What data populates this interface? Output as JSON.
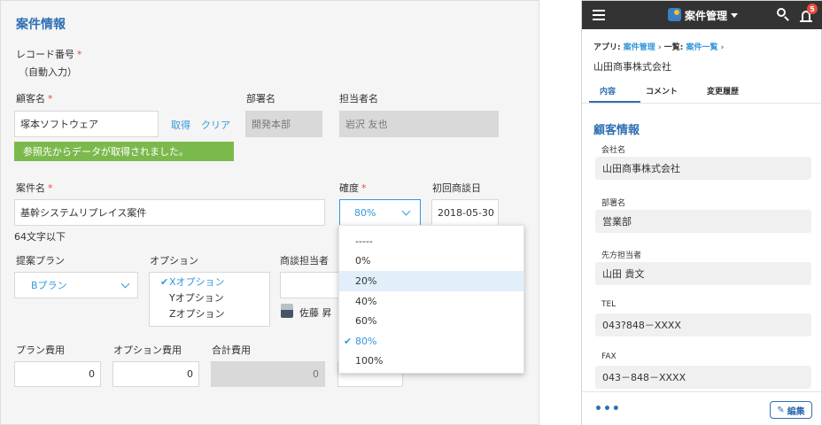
{
  "form": {
    "section_title": "案件情報",
    "record_number": {
      "label": "レコード番号",
      "value": "（自動入力）"
    },
    "customer": {
      "label": "顧客名",
      "value": "塚本ソフトウェア",
      "fetch": "取得",
      "clear": "クリア"
    },
    "department": {
      "label": "部署名",
      "value": "開発本部"
    },
    "contact": {
      "label": "担当者名",
      "value": "岩沢 友也"
    },
    "success_message": "参照先からデータが取得されました。",
    "project": {
      "label": "案件名",
      "value": "基幹システムリプレイス案件",
      "hint": "64文字以下"
    },
    "probability": {
      "label": "確度",
      "value": "80%"
    },
    "first_meeting": {
      "label": "初回商談日",
      "value": "2018-05-30"
    },
    "plan": {
      "label": "提案プラン",
      "value": "Bプラン"
    },
    "options": {
      "label": "オプション",
      "items": [
        {
          "label": "Xオプション",
          "checked": true
        },
        {
          "label": "Yオプション",
          "checked": false
        },
        {
          "label": "Zオプション",
          "checked": false
        }
      ]
    },
    "sales_rep": {
      "label": "商談担当者",
      "user": "佐藤 昇"
    },
    "plan_cost": {
      "label": "プラン費用",
      "value": "0"
    },
    "option_cost": {
      "label": "オプション費用",
      "value": "0"
    },
    "total_cost": {
      "label": "合計費用",
      "value": "0"
    },
    "probability_dropdown": {
      "options": [
        "-----",
        "0%",
        "20%",
        "40%",
        "60%",
        "80%",
        "100%"
      ],
      "highlighted": "20%",
      "selected": "80%"
    }
  },
  "mobile": {
    "app_title": "案件管理",
    "notification_count": "5",
    "breadcrumb": {
      "app_prefix": "アプリ:",
      "app_link": "案件管理",
      "list_prefix": "一覧:",
      "list_link": "案件一覧"
    },
    "record_title": "山田商事株式会社",
    "tabs": [
      "内容",
      "コメント",
      "変更履歴"
    ],
    "section_title": "顧客情報",
    "fields": [
      {
        "label": "会社名",
        "value": "山田商事株式会社"
      },
      {
        "label": "部署名",
        "value": "営業部"
      },
      {
        "label": "先方担当者",
        "value": "山田 貴文"
      },
      {
        "label": "TEL",
        "value": "043?848－XXXX"
      },
      {
        "label": "FAX",
        "value": "043－848－XXXX"
      }
    ],
    "more": "•••",
    "edit_label": "編集"
  },
  "colors": {
    "accent": "#3498db",
    "heading": "#2f6fb3",
    "success": "#7cb94d",
    "required": "#e74c3c",
    "header_bg": "#333333"
  }
}
